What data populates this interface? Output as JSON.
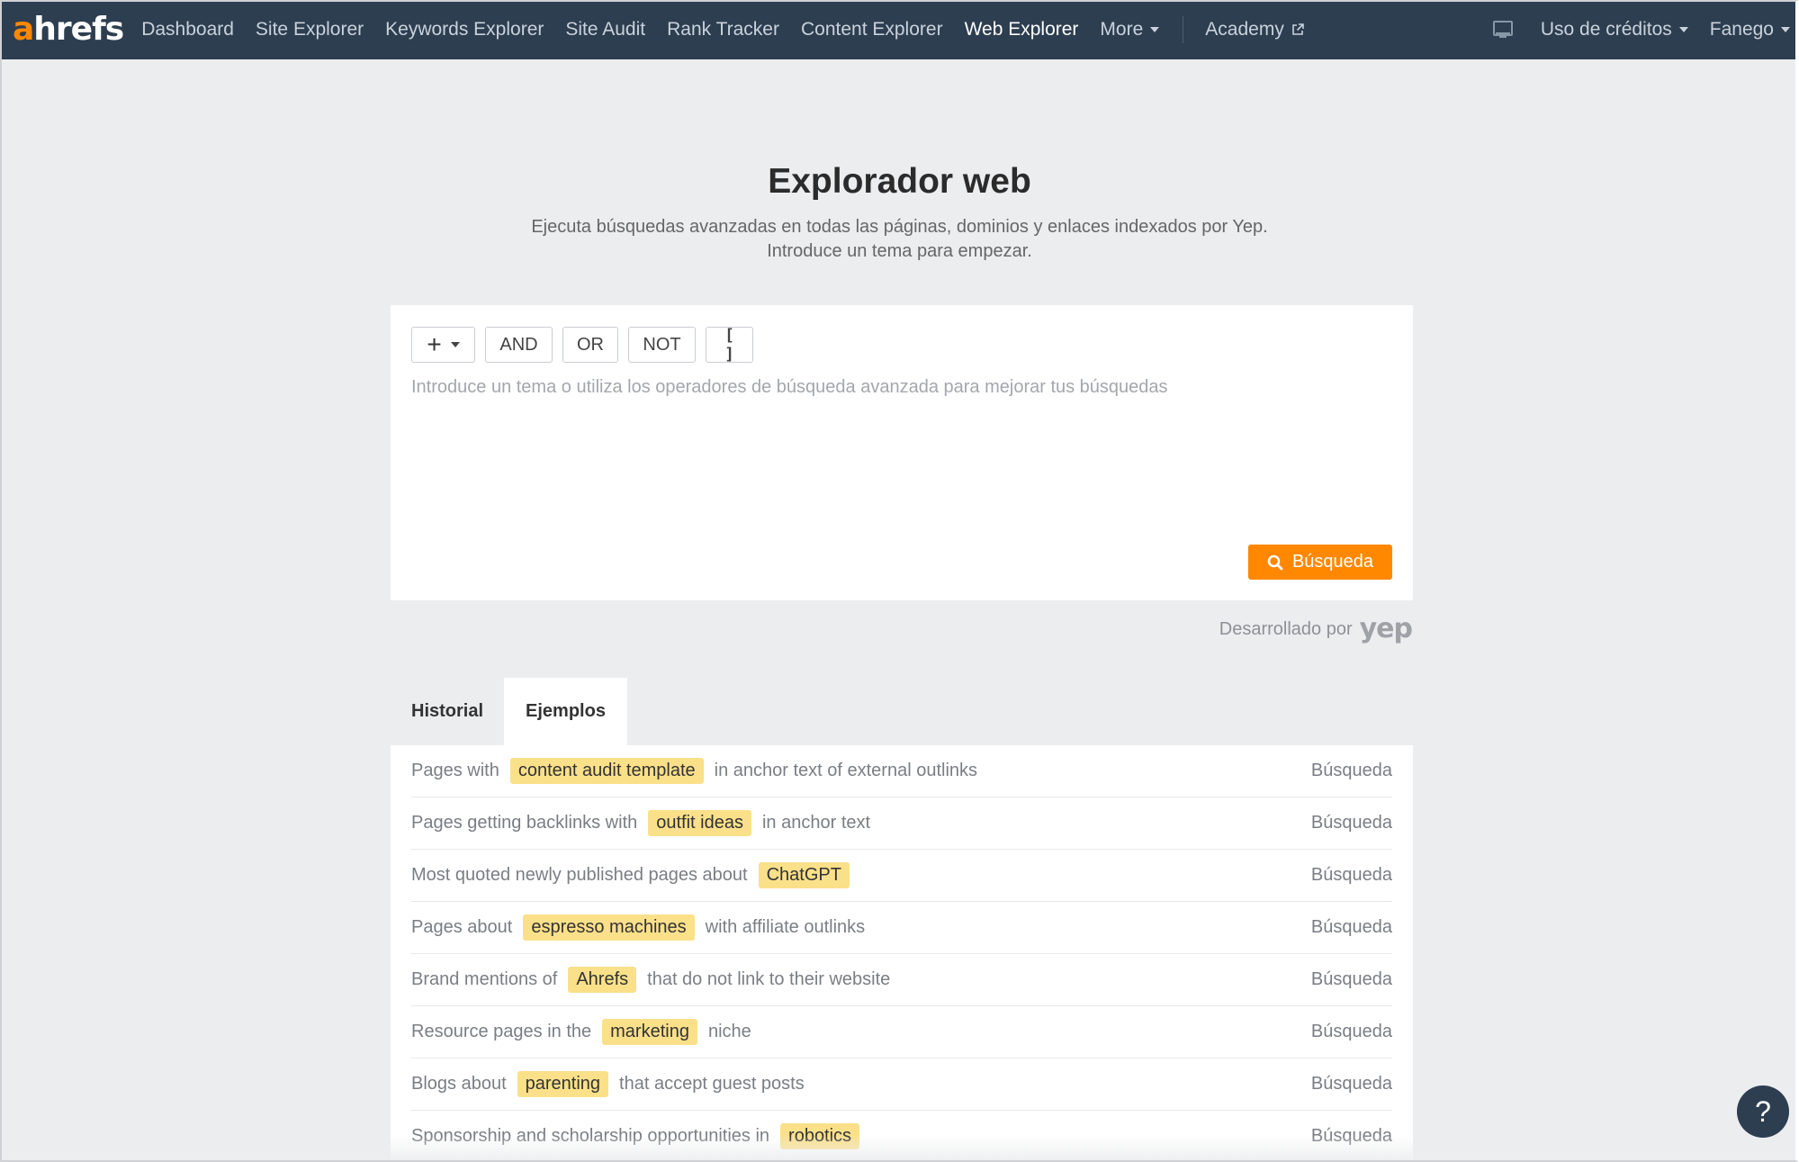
{
  "nav": {
    "logo_accent": "a",
    "logo_rest": "hrefs",
    "items": [
      {
        "label": "Dashboard",
        "active": false
      },
      {
        "label": "Site Explorer",
        "active": false
      },
      {
        "label": "Keywords Explorer",
        "active": false
      },
      {
        "label": "Site Audit",
        "active": false
      },
      {
        "label": "Rank Tracker",
        "active": false
      },
      {
        "label": "Content Explorer",
        "active": false
      },
      {
        "label": "Web Explorer",
        "active": true
      }
    ],
    "more_label": "More",
    "academy_label": "Academy",
    "credits_label": "Uso de créditos",
    "user_label": "Fanego"
  },
  "hero": {
    "title": "Explorador web",
    "subtitle_line1": "Ejecuta búsquedas avanzadas en todas las páginas, dominios y enlaces indexados por Yep.",
    "subtitle_line2": "Introduce un tema para empezar."
  },
  "search": {
    "operators": {
      "plus": "+",
      "and": "AND",
      "or": "OR",
      "not": "NOT",
      "brackets": "[ ]"
    },
    "placeholder": "Introduce un tema o utiliza los operadores de búsqueda avanzada para mejorar tus búsquedas",
    "value": "",
    "button_label": "Búsqueda",
    "powered_label": "Desarrollado por",
    "powered_brand": "yep"
  },
  "tabs": [
    {
      "label": "Historial",
      "active": false
    },
    {
      "label": "Ejemplos",
      "active": true
    }
  ],
  "examples": [
    {
      "before": "Pages with",
      "highlight": "content audit template",
      "after": "in anchor text of external outlinks",
      "action": "Búsqueda"
    },
    {
      "before": "Pages getting backlinks with",
      "highlight": "outfit ideas",
      "after": "in anchor text",
      "action": "Búsqueda"
    },
    {
      "before": "Most quoted newly published pages about",
      "highlight": "ChatGPT",
      "after": "",
      "action": "Búsqueda"
    },
    {
      "before": "Pages about",
      "highlight": "espresso machines",
      "after": "with affiliate outlinks",
      "action": "Búsqueda"
    },
    {
      "before": "Brand mentions of",
      "highlight": "Ahrefs",
      "after": "that do not link to their website",
      "action": "Búsqueda"
    },
    {
      "before": "Resource pages in the",
      "highlight": "marketing",
      "after": "niche",
      "action": "Búsqueda"
    },
    {
      "before": "Blogs about",
      "highlight": "parenting",
      "after": "that accept guest posts",
      "action": "Búsqueda"
    },
    {
      "before": "Sponsorship and scholarship opportunities in",
      "highlight": "robotics",
      "after": "",
      "action": "Búsqueda"
    }
  ],
  "help": {
    "label": "?"
  },
  "colors": {
    "nav_bg": "#2d3e50",
    "accent": "#ff8800",
    "highlight": "#fbe08a",
    "page_bg": "#ecedef"
  }
}
